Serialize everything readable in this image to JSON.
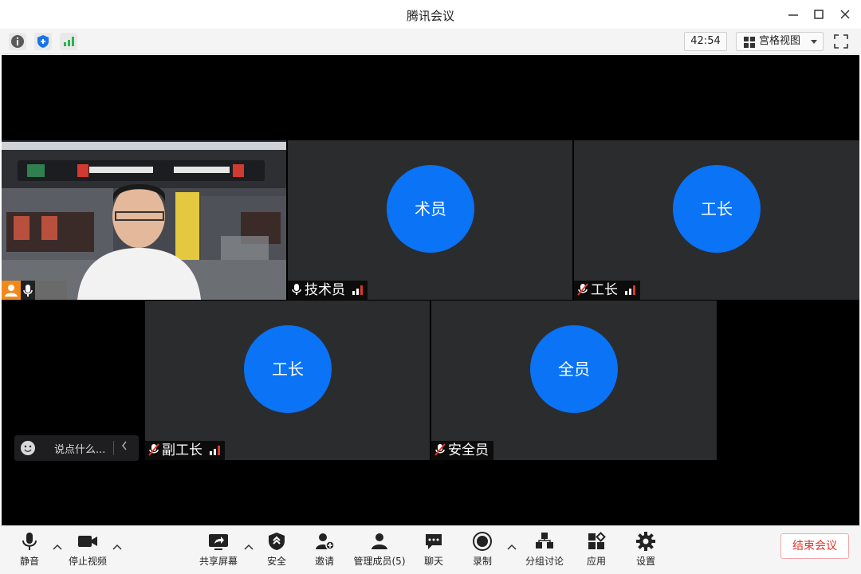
{
  "window": {
    "title": "腾讯会议"
  },
  "toolbar": {
    "timer": "42:54",
    "view_label": "宫格视图"
  },
  "participants": [
    {
      "name": "",
      "type": "video"
    },
    {
      "name": "技术员",
      "avatar_text": "术员"
    },
    {
      "name": "工长",
      "avatar_text": "工长"
    },
    {
      "name": "副工长",
      "avatar_text": "工长"
    },
    {
      "name": "安全员",
      "avatar_text": "全员"
    }
  ],
  "chat": {
    "placeholder": "说点什么..."
  },
  "bottombar": {
    "mute": "静音",
    "stop_video": "停止视频",
    "share_screen": "共享屏幕",
    "security": "安全",
    "invite": "邀请",
    "manage_members": "管理成员(5)",
    "chat": "聊天",
    "record": "录制",
    "breakout": "分组讨论",
    "apps": "应用",
    "settings": "设置",
    "end_meeting": "结束会议"
  },
  "colors": {
    "avatar_blue": "#0a73f6",
    "tile_bg": "#2b2c2e",
    "signal_red": "#e0362c"
  }
}
